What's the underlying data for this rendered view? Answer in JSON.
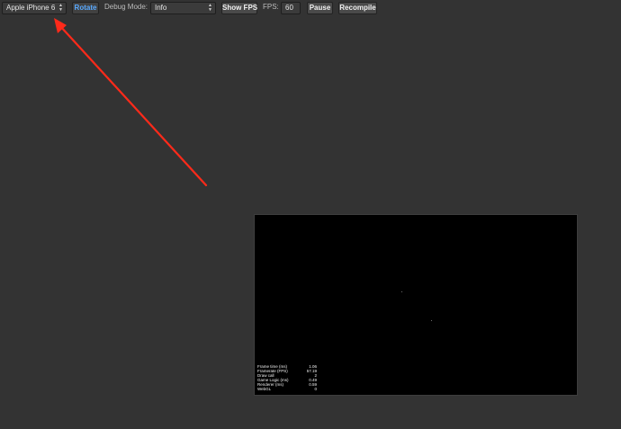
{
  "toolbar": {
    "device_select": {
      "value": "Apple iPhone 6"
    },
    "rotate_label": "Rotate",
    "debug_mode_label": "Debug Mode:",
    "debug_mode_select": {
      "value": "Info"
    },
    "show_fps_label": "Show FPS",
    "fps_label": "FPS:",
    "fps_value": "60",
    "pause_label": "Pause",
    "recompile_label": "Recompile"
  },
  "colors": {
    "background": "#333333",
    "canvas": "#000000",
    "accent_blue": "#58a9ff",
    "annotation_arrow": "#ff2a1a"
  },
  "icons": {
    "select_arrows": "up-down-chevron-icon"
  },
  "stats": {
    "rows": [
      {
        "label": "Frame time (ms)",
        "value": "1.06"
      },
      {
        "label": "Framerate (FPS)",
        "value": "57.19"
      },
      {
        "label": "Draw call",
        "value": "2"
      },
      {
        "label": "Game Logic (ms)",
        "value": "0.49"
      },
      {
        "label": "Renderer (ms)",
        "value": "0.59"
      },
      {
        "label": "WebGL",
        "value": "0"
      }
    ]
  }
}
